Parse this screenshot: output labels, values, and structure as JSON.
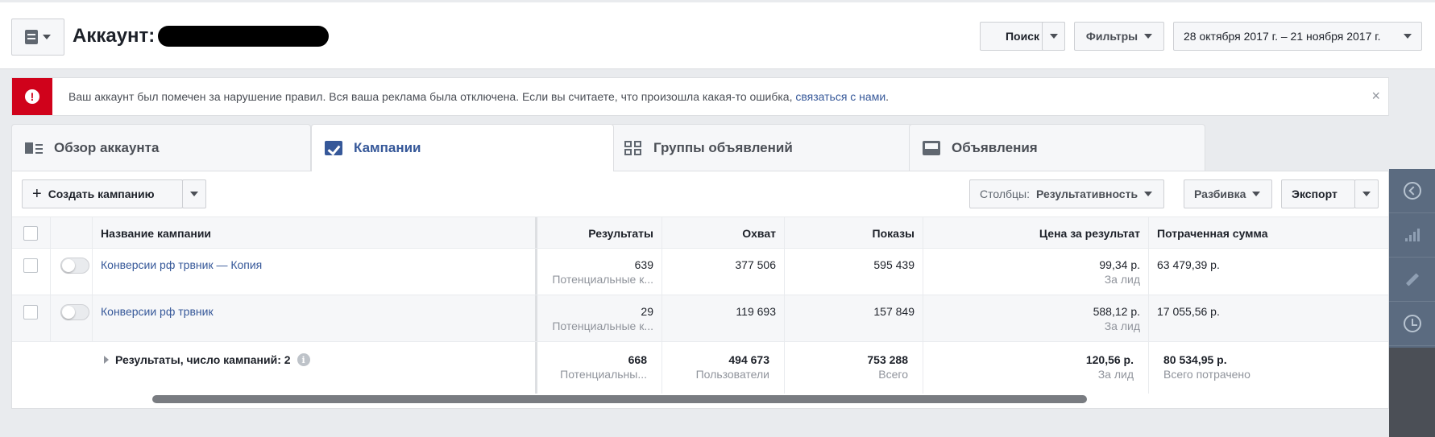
{
  "header": {
    "account_label": "Аккаунт:",
    "search_label": "Поиск",
    "filters_label": "Фильтры",
    "date_range": "28 октября 2017 г. – 21 ноября 2017 г."
  },
  "alert": {
    "message": "Ваш аккаунт был помечен за нарушение правил. Вся ваша реклама была отключена. Если вы считаете, что произошла какая-то ошибка, ",
    "link": "связаться с нами",
    "tail": ".",
    "close": "×"
  },
  "tabs": [
    {
      "label": "Обзор аккаунта"
    },
    {
      "label": "Кампании"
    },
    {
      "label": "Группы объявлений"
    },
    {
      "label": "Объявления"
    }
  ],
  "toolbar": {
    "create_label": "Создать кампанию",
    "columns_prefix": "Столбцы:",
    "columns_value": "Результативность",
    "breakdown_label": "Разбивка",
    "export_label": "Экспорт"
  },
  "table": {
    "headers": {
      "name": "Название кампании",
      "results": "Результаты",
      "reach": "Охват",
      "impressions": "Показы",
      "cost_per_result": "Цена за результат",
      "spent": "Потраченная сумма"
    },
    "rows": [
      {
        "name": "Конверсии рф трвник — Копия",
        "results": "639",
        "results_sub": "Потенциальные к...",
        "reach": "377 506",
        "impressions": "595 439",
        "cpr": "99,34 р.",
        "cpr_sub": "За лид",
        "spent": "63 479,39 р."
      },
      {
        "name": "Конверсии рф трвник",
        "results": "29",
        "results_sub": "Потенциальные к...",
        "reach": "119 693",
        "impressions": "157 849",
        "cpr": "588,12 р.",
        "cpr_sub": "За лид",
        "spent": "17 055,56 р."
      }
    ],
    "total": {
      "label": "Результаты, число кампаний: 2",
      "results": "668",
      "results_sub": "Потенциальны...",
      "reach": "494 673",
      "reach_sub": "Пользователи",
      "impressions": "753 288",
      "impressions_sub": "Всего",
      "cpr": "120,56 р.",
      "cpr_sub": "За лид",
      "spent": "80 534,95 р.",
      "spent_sub": "Всего потрачено"
    }
  },
  "colors": {
    "accent": "#365899",
    "alert": "#d0021b"
  }
}
